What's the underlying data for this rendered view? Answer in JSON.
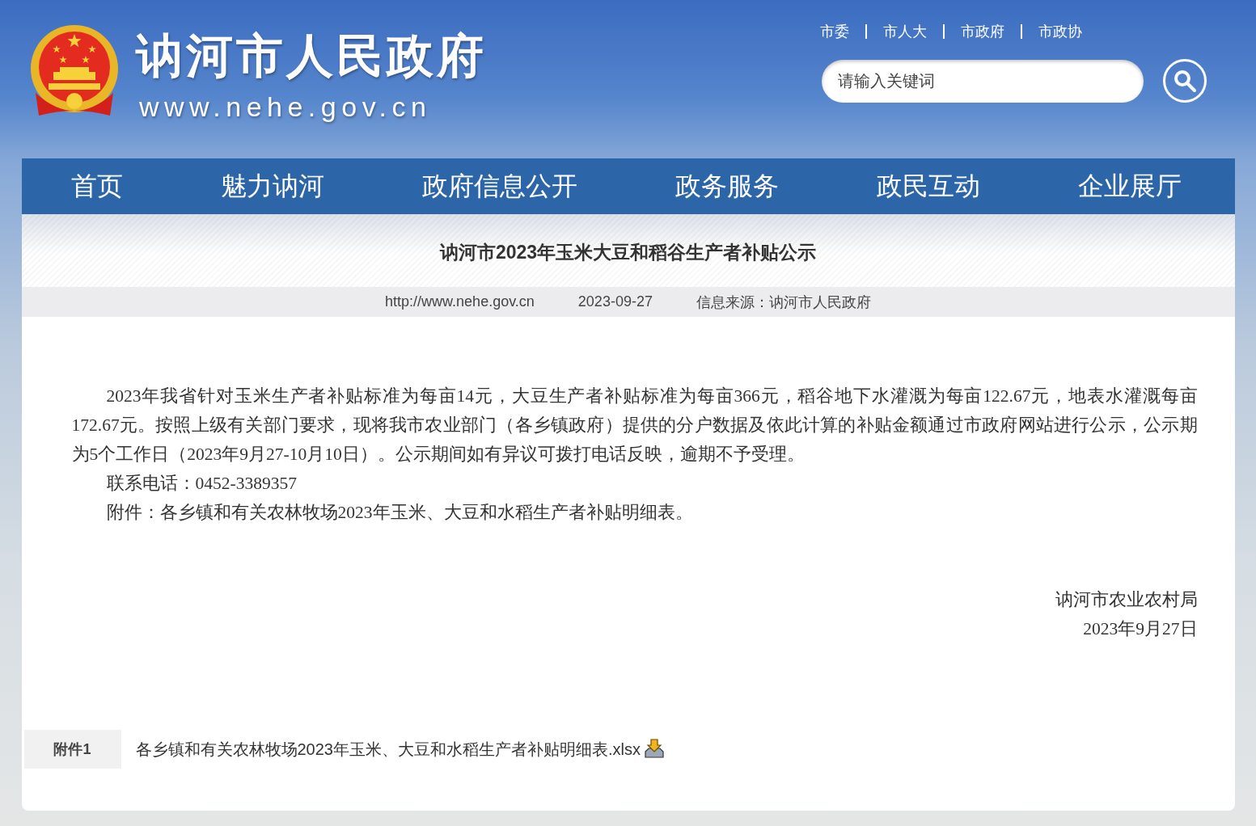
{
  "header": {
    "site_name": "讷河市人民政府",
    "site_url": "www.nehe.gov.cn",
    "top_links": [
      "市委",
      "市人大",
      "市政府",
      "市政协"
    ],
    "search": {
      "placeholder": "请输入关键词"
    }
  },
  "nav": [
    "首页",
    "魅力讷河",
    "政府信息公开",
    "政务服务",
    "政民互动",
    "企业展厅"
  ],
  "article": {
    "title": "讷河市2023年玉米大豆和稻谷生产者补贴公示",
    "meta": [
      "http://www.nehe.gov.cn",
      "2023-09-27",
      "信息来源：讷河市人民政府"
    ],
    "paragraphs": [
      "2023年我省针对玉米生产者补贴标准为每亩14元，大豆生产者补贴标准为每亩366元，稻谷地下水灌溉为每亩122.67元，地表水灌溉每亩172.67元。按照上级有关部门要求，现将我市农业部门（各乡镇政府）提供的分户数据及依此计算的补贴金额通过市政府网站进行公示，公示期为5个工作日（2023年9月27-10月10日）。公示期间如有异议可拨打电话反映，逾期不予受理。",
      "联系电话：0452-3389357",
      "附件：各乡镇和有关农林牧场2023年玉米、大豆和水稻生产者补贴明细表。"
    ],
    "signature": [
      "讷河市农业农村局",
      "2023年9月27日"
    ]
  },
  "attachments": [
    {
      "label": "附件1",
      "file": "各乡镇和有关农林牧场2023年玉米、大豆和水稻生产者补贴明细表.xlsx"
    }
  ]
}
